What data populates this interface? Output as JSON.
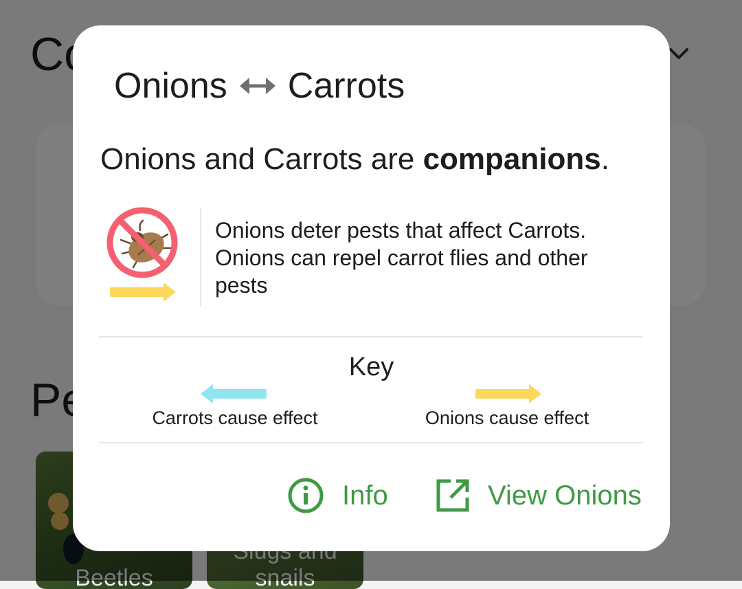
{
  "background": {
    "section_heading_1": "Co",
    "section_heading_2": "Pe",
    "pests": [
      {
        "label": "Beetles"
      },
      {
        "label": "Slugs and snails"
      }
    ]
  },
  "dialog": {
    "title": {
      "plant_a": "Onions",
      "plant_b": "Carrots"
    },
    "statement": {
      "prefix": "Onions and Carrots are ",
      "relationship": "companions",
      "suffix": "."
    },
    "effect": {
      "icon": "pest-deter-icon",
      "line1": "Onions deter pests that affect Carrots.",
      "line2": "Onions can repel carrot flies and other pests"
    },
    "key": {
      "title": "Key",
      "left_label": "Carrots cause effect",
      "right_label": "Onions cause effect"
    },
    "actions": {
      "info_label": "Info",
      "view_label": "View Onions"
    }
  },
  "colors": {
    "accent_green": "#3f9a44",
    "arrow_yellow": "#fbd85a",
    "arrow_cyan": "#8ee6ef",
    "prohibit_red": "#f4606f"
  }
}
